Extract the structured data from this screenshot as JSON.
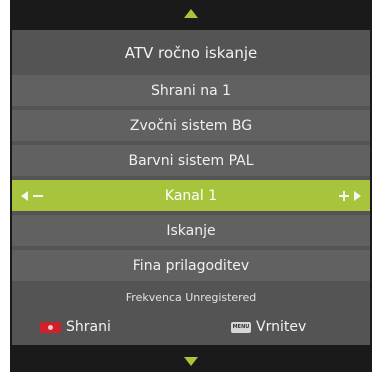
{
  "menu": {
    "title": "ATV ročno iskanje",
    "items": [
      {
        "label": "Shrani na 1"
      },
      {
        "label": "Zvočni sistem BG"
      },
      {
        "label": "Barvni sistem PAL"
      },
      {
        "label": "Kanal 1",
        "selected": true
      },
      {
        "label": "Iskanje"
      },
      {
        "label": "Fina prilagoditev"
      }
    ],
    "frequency": "Frekvenca Unregistered"
  },
  "footer": {
    "save_label": "Shrani",
    "back_label": "Vrnitev",
    "menu_key_label": "MENU"
  },
  "icons": {
    "up": "arrow-up-icon",
    "down": "arrow-down-icon",
    "left": "triangle-left-icon",
    "right": "triangle-right-icon",
    "minus": "minus-icon",
    "plus": "plus-icon",
    "red": "red-key-icon",
    "menu": "menu-key-icon"
  },
  "colors": {
    "accent": "#a8c43c",
    "panel": "#545454",
    "item": "#616161",
    "background": "#1a1a1a",
    "red_key": "#d21f2a"
  }
}
